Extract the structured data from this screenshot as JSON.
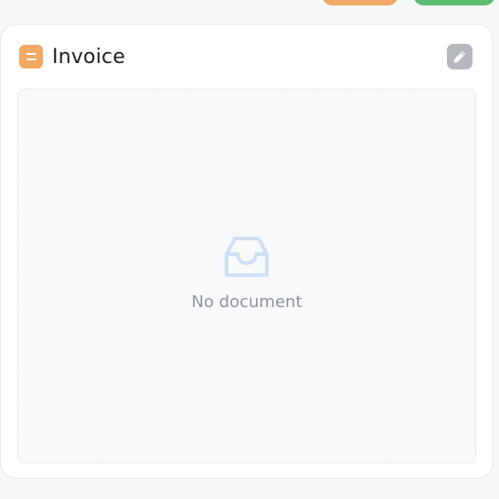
{
  "card": {
    "title": "Invoice",
    "title_icon": "document-icon",
    "edit_icon": "pencil-icon"
  },
  "dropzone": {
    "empty_icon": "inbox-icon",
    "empty_text": "No document"
  },
  "colors": {
    "accent_orange": "#f2a964",
    "accent_green": "#5cbd6e",
    "empty_icon": "#cfdff3",
    "muted_text": "#8e949e"
  }
}
